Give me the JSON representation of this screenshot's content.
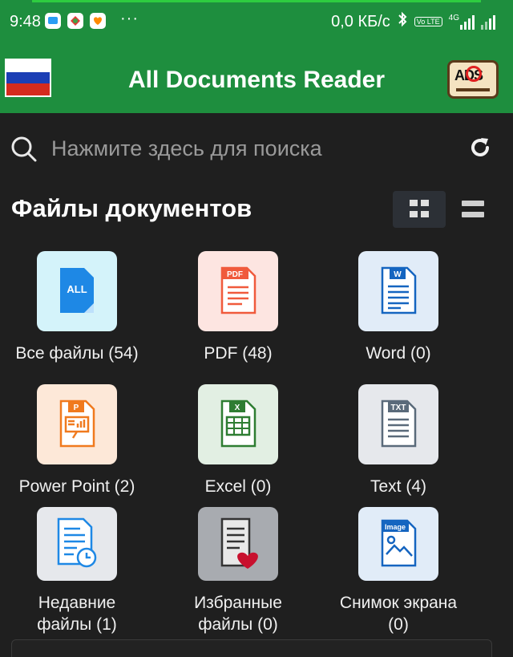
{
  "status_bar": {
    "time": "9:48",
    "more_indicator": "···",
    "net_speed": "0,0 КБ/с",
    "network_label": "4G",
    "volte_label": "Vo LTE"
  },
  "app_bar": {
    "title": "All Documents Reader",
    "language_flag": "russia-flag",
    "no_ads_text": "ADS"
  },
  "search": {
    "placeholder": "Нажмите здесь для поиска"
  },
  "section": {
    "title": "Файлы документов"
  },
  "categories": [
    {
      "label": "Все файлы (54)",
      "icon": "all-files-icon",
      "badge": "ALL",
      "bg": "#d4f3fa",
      "accent": "#1e88e5"
    },
    {
      "label": "PDF (48)",
      "icon": "pdf-icon",
      "badge": "PDF",
      "bg": "#fde5e1",
      "accent": "#f05a3c"
    },
    {
      "label": "Word (0)",
      "icon": "word-icon",
      "badge": "W",
      "bg": "#e1ecf8",
      "accent": "#1565c0"
    },
    {
      "label": "Power Point (2)",
      "icon": "powerpoint-icon",
      "badge": "P",
      "bg": "#fde8d8",
      "accent": "#f07a1e"
    },
    {
      "label": "Excel (0)",
      "icon": "excel-icon",
      "badge": "X",
      "bg": "#e2efe3",
      "accent": "#2e7d32"
    },
    {
      "label": "Text (4)",
      "icon": "text-icon",
      "badge": "TXT",
      "bg": "#e6e8ec",
      "accent": "#5a6a7a"
    },
    {
      "label": "Недавние\nфайлы (1)",
      "icon": "recent-files-icon",
      "badge": "",
      "bg": "#e6e8ec",
      "accent": "#1e88e5"
    },
    {
      "label": "Избранные\nфайлы (0)",
      "icon": "favorite-files-icon",
      "badge": "",
      "bg": "#a8abb0",
      "accent": "#c8102e"
    },
    {
      "label": "Снимок экрана\n(0)",
      "icon": "screenshot-icon",
      "badge": "Image",
      "bg": "#e1ecf8",
      "accent": "#1565c0"
    }
  ]
}
